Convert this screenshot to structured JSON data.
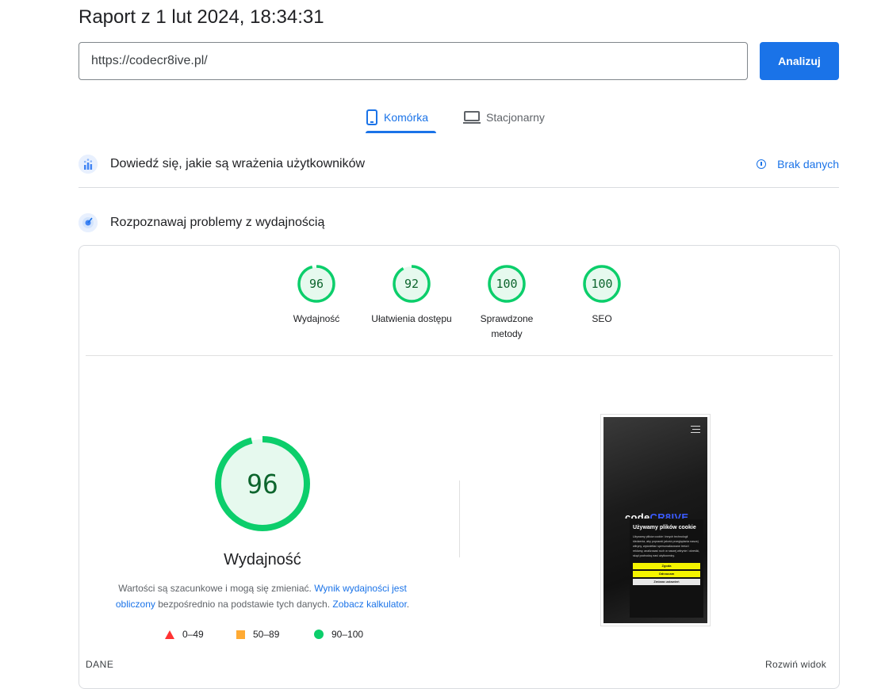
{
  "header": {
    "report_title": "Raport z 1 lut 2024, 18:34:31",
    "url_value": "https://codecr8ive.pl/",
    "analyze_label": "Analizuj"
  },
  "tabs": [
    {
      "label": "Komórka",
      "icon": "phone-icon",
      "active": true
    },
    {
      "label": "Stacjonarny",
      "icon": "laptop-icon",
      "active": false
    }
  ],
  "ux_section": {
    "title": "Dowiedź się, jakie są wrażenia użytkowników",
    "status_label": "Brak danych",
    "icon": "ux-icon"
  },
  "perf_section": {
    "title": "Rozpoznawaj problemy z wydajnością",
    "icon": "lighthouse-icon"
  },
  "scores": [
    {
      "value": "96",
      "label": "Wydajność"
    },
    {
      "value": "92",
      "label": "Ułatwienia dostępu"
    },
    {
      "value": "100",
      "label": "Sprawdzone metody"
    },
    {
      "value": "100",
      "label": "SEO"
    }
  ],
  "main_score": {
    "value": "96",
    "title": "Wydajność",
    "note_text_1": "Wartości są szacunkowe i mogą się zmieniać.",
    "note_link_1": "Wynik wydajności jest obliczony",
    "note_text_2": "bezpośrednio na podstawie tych danych.",
    "note_link_2": "Zobacz kalkulator",
    "note_text_3": "."
  },
  "legend": [
    {
      "range": "0–49",
      "shape": "triangle",
      "color": "#ff3333"
    },
    {
      "range": "50–89",
      "shape": "square",
      "color": "#ffaa33"
    },
    {
      "range": "90–100",
      "shape": "circle",
      "color": "#0cce6b"
    }
  ],
  "thumbnail": {
    "logo_plain": "code",
    "logo_highlight": "CR8IVE",
    "cookie_title": "Używamy plików cookie",
    "cookie_text": "Używamy plików cookie i innych technologii śledzenia, aby poprawić jakość przeglądania naszej witryny, wyświetlać spersonalizowane treści i reklamy, analizować ruch w naszej witrynie i określić, skąd pochodzą nasi użytkownicy.",
    "accept_label": "Zgoda",
    "reject_label": "Odrzucam",
    "settings_label": "Zmiana ustawień"
  },
  "footer": {
    "left": "DANE",
    "right": "Rozwiń widok"
  },
  "colors": {
    "accent": "#1a73e8",
    "pass_stroke": "#0cce6b",
    "pass_fill": "#e6f9ee",
    "pass_text": "#0d652d"
  }
}
